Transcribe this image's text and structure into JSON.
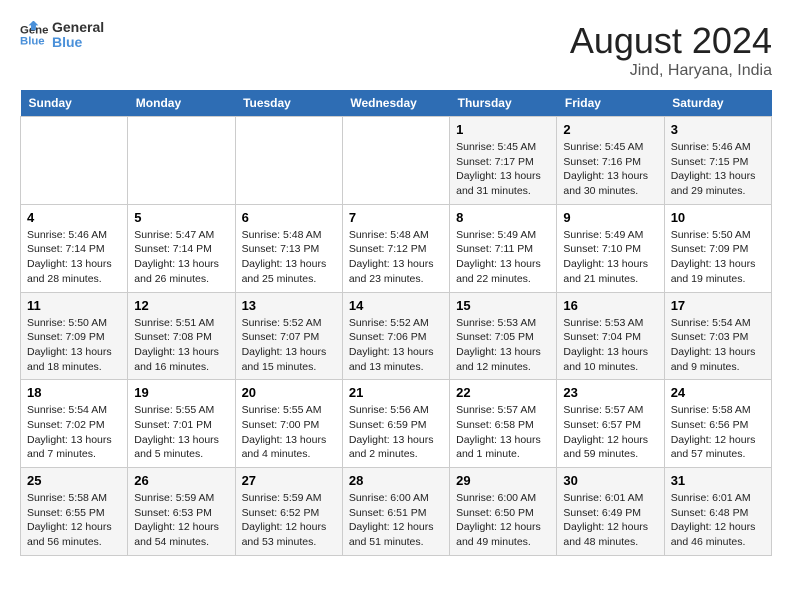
{
  "logo": {
    "line1": "General",
    "line2": "Blue"
  },
  "title": "August 2024",
  "location": "Jind, Haryana, India",
  "days_header": [
    "Sunday",
    "Monday",
    "Tuesday",
    "Wednesday",
    "Thursday",
    "Friday",
    "Saturday"
  ],
  "weeks": [
    [
      {
        "num": "",
        "info": ""
      },
      {
        "num": "",
        "info": ""
      },
      {
        "num": "",
        "info": ""
      },
      {
        "num": "",
        "info": ""
      },
      {
        "num": "1",
        "info": "Sunrise: 5:45 AM\nSunset: 7:17 PM\nDaylight: 13 hours\nand 31 minutes."
      },
      {
        "num": "2",
        "info": "Sunrise: 5:45 AM\nSunset: 7:16 PM\nDaylight: 13 hours\nand 30 minutes."
      },
      {
        "num": "3",
        "info": "Sunrise: 5:46 AM\nSunset: 7:15 PM\nDaylight: 13 hours\nand 29 minutes."
      }
    ],
    [
      {
        "num": "4",
        "info": "Sunrise: 5:46 AM\nSunset: 7:14 PM\nDaylight: 13 hours\nand 28 minutes."
      },
      {
        "num": "5",
        "info": "Sunrise: 5:47 AM\nSunset: 7:14 PM\nDaylight: 13 hours\nand 26 minutes."
      },
      {
        "num": "6",
        "info": "Sunrise: 5:48 AM\nSunset: 7:13 PM\nDaylight: 13 hours\nand 25 minutes."
      },
      {
        "num": "7",
        "info": "Sunrise: 5:48 AM\nSunset: 7:12 PM\nDaylight: 13 hours\nand 23 minutes."
      },
      {
        "num": "8",
        "info": "Sunrise: 5:49 AM\nSunset: 7:11 PM\nDaylight: 13 hours\nand 22 minutes."
      },
      {
        "num": "9",
        "info": "Sunrise: 5:49 AM\nSunset: 7:10 PM\nDaylight: 13 hours\nand 21 minutes."
      },
      {
        "num": "10",
        "info": "Sunrise: 5:50 AM\nSunset: 7:09 PM\nDaylight: 13 hours\nand 19 minutes."
      }
    ],
    [
      {
        "num": "11",
        "info": "Sunrise: 5:50 AM\nSunset: 7:09 PM\nDaylight: 13 hours\nand 18 minutes."
      },
      {
        "num": "12",
        "info": "Sunrise: 5:51 AM\nSunset: 7:08 PM\nDaylight: 13 hours\nand 16 minutes."
      },
      {
        "num": "13",
        "info": "Sunrise: 5:52 AM\nSunset: 7:07 PM\nDaylight: 13 hours\nand 15 minutes."
      },
      {
        "num": "14",
        "info": "Sunrise: 5:52 AM\nSunset: 7:06 PM\nDaylight: 13 hours\nand 13 minutes."
      },
      {
        "num": "15",
        "info": "Sunrise: 5:53 AM\nSunset: 7:05 PM\nDaylight: 13 hours\nand 12 minutes."
      },
      {
        "num": "16",
        "info": "Sunrise: 5:53 AM\nSunset: 7:04 PM\nDaylight: 13 hours\nand 10 minutes."
      },
      {
        "num": "17",
        "info": "Sunrise: 5:54 AM\nSunset: 7:03 PM\nDaylight: 13 hours\nand 9 minutes."
      }
    ],
    [
      {
        "num": "18",
        "info": "Sunrise: 5:54 AM\nSunset: 7:02 PM\nDaylight: 13 hours\nand 7 minutes."
      },
      {
        "num": "19",
        "info": "Sunrise: 5:55 AM\nSunset: 7:01 PM\nDaylight: 13 hours\nand 5 minutes."
      },
      {
        "num": "20",
        "info": "Sunrise: 5:55 AM\nSunset: 7:00 PM\nDaylight: 13 hours\nand 4 minutes."
      },
      {
        "num": "21",
        "info": "Sunrise: 5:56 AM\nSunset: 6:59 PM\nDaylight: 13 hours\nand 2 minutes."
      },
      {
        "num": "22",
        "info": "Sunrise: 5:57 AM\nSunset: 6:58 PM\nDaylight: 13 hours\nand 1 minute."
      },
      {
        "num": "23",
        "info": "Sunrise: 5:57 AM\nSunset: 6:57 PM\nDaylight: 12 hours\nand 59 minutes."
      },
      {
        "num": "24",
        "info": "Sunrise: 5:58 AM\nSunset: 6:56 PM\nDaylight: 12 hours\nand 57 minutes."
      }
    ],
    [
      {
        "num": "25",
        "info": "Sunrise: 5:58 AM\nSunset: 6:55 PM\nDaylight: 12 hours\nand 56 minutes."
      },
      {
        "num": "26",
        "info": "Sunrise: 5:59 AM\nSunset: 6:53 PM\nDaylight: 12 hours\nand 54 minutes."
      },
      {
        "num": "27",
        "info": "Sunrise: 5:59 AM\nSunset: 6:52 PM\nDaylight: 12 hours\nand 53 minutes."
      },
      {
        "num": "28",
        "info": "Sunrise: 6:00 AM\nSunset: 6:51 PM\nDaylight: 12 hours\nand 51 minutes."
      },
      {
        "num": "29",
        "info": "Sunrise: 6:00 AM\nSunset: 6:50 PM\nDaylight: 12 hours\nand 49 minutes."
      },
      {
        "num": "30",
        "info": "Sunrise: 6:01 AM\nSunset: 6:49 PM\nDaylight: 12 hours\nand 48 minutes."
      },
      {
        "num": "31",
        "info": "Sunrise: 6:01 AM\nSunset: 6:48 PM\nDaylight: 12 hours\nand 46 minutes."
      }
    ]
  ]
}
